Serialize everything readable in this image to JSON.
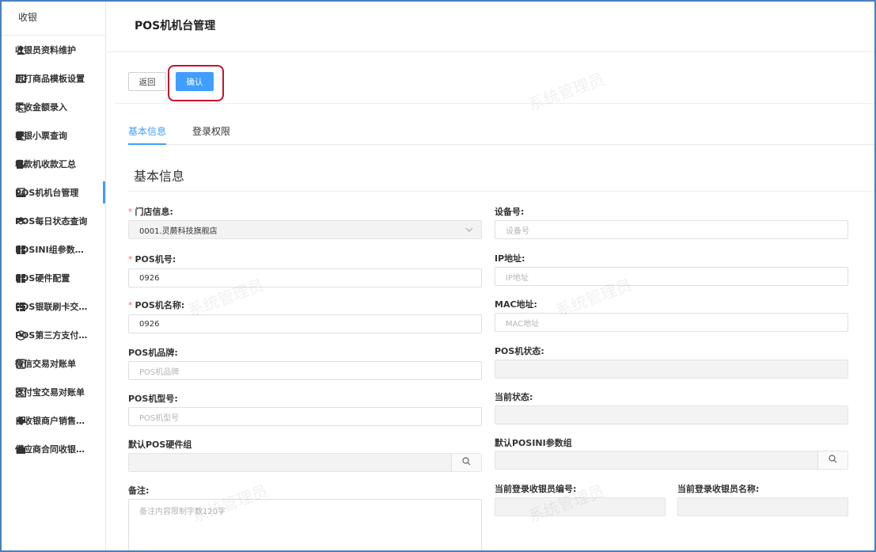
{
  "sidebar": {
    "header": "收银",
    "items": [
      {
        "label": "收银员资料维护",
        "icon": "user-icon"
      },
      {
        "label": "厨打商品模板设置",
        "icon": "template-icon"
      },
      {
        "label": "实收金额录入",
        "icon": "copy-icon"
      },
      {
        "label": "收银小票查询",
        "icon": "receipt-icon"
      },
      {
        "label": "收款机收款汇总",
        "icon": "edit-doc-icon"
      },
      {
        "label": "POS机机台管理",
        "icon": "pos-icon"
      },
      {
        "label": "POS每日状态查询",
        "icon": "layers-icon"
      },
      {
        "label": "POSINI组参数设置",
        "icon": "grid-icon"
      },
      {
        "label": "POS硬件配置",
        "icon": "grid-icon"
      },
      {
        "label": "POS银联刷卡交易...",
        "icon": "list-icon"
      },
      {
        "label": "POS第三方支付付...",
        "icon": "eye-icon"
      },
      {
        "label": "微信交易对账单",
        "icon": "checkbox-icon"
      },
      {
        "label": "支付宝交易对账单",
        "icon": "alipay-icon"
      },
      {
        "label": "自收银商户销售录入",
        "icon": "tag-icon"
      },
      {
        "label": "供应商合同收银付...",
        "icon": "bag-icon"
      }
    ]
  },
  "page": {
    "title": "POS机机台管理"
  },
  "toolbar": {
    "back_label": "返回",
    "confirm_label": "确认"
  },
  "tabs": {
    "basic": "基本信息",
    "login": "登录权限"
  },
  "section": {
    "title": "基本信息"
  },
  "form": {
    "store": {
      "label": "门店信息:",
      "value": "0001.灵蕨科技旗舰店"
    },
    "device_no": {
      "label": "设备号:",
      "placeholder": "设备号"
    },
    "pos_no": {
      "label": "POS机号:",
      "value": "0926"
    },
    "ip": {
      "label": "IP地址:",
      "placeholder": "IP地址"
    },
    "pos_name": {
      "label": "POS机名称:",
      "value": "0926"
    },
    "mac": {
      "label": "MAC地址:",
      "placeholder": "MAC地址"
    },
    "brand": {
      "label": "POS机品牌:",
      "placeholder": "POS机品牌"
    },
    "pos_status": {
      "label": "POS机状态:"
    },
    "model": {
      "label": "POS机型号:",
      "placeholder": "POS机型号"
    },
    "current_status": {
      "label": "当前状态:"
    },
    "hw_group": {
      "label": "默认POS硬件组"
    },
    "ini_group": {
      "label": "默认POSINI参数组"
    },
    "remark": {
      "label": "备注:",
      "placeholder": "备注内容限制字数120字"
    },
    "cashier_no": {
      "label": "当前登录收银员编号:"
    },
    "cashier_name": {
      "label": "当前登录收银员名称:"
    }
  },
  "watermark": "系统管理员",
  "colors": {
    "primary": "#409eff",
    "highlight": "#c8102e",
    "required": "#f56c6c"
  }
}
